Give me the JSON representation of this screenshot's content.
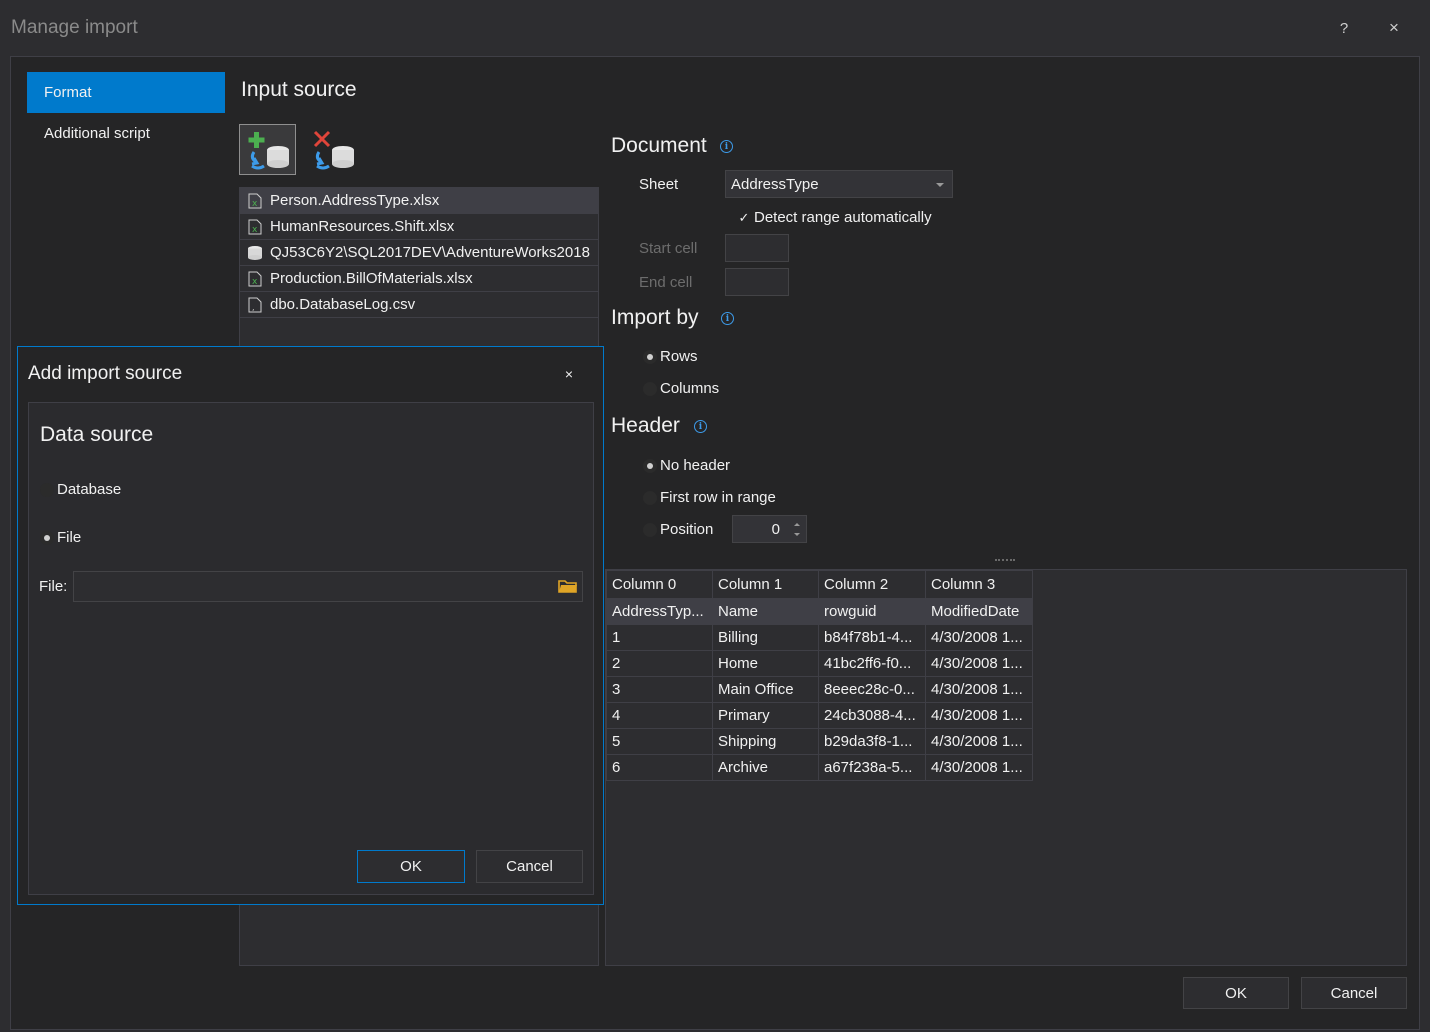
{
  "window": {
    "title": "Manage import",
    "help_label": "?",
    "close_label": "×"
  },
  "nav": [
    {
      "label": "Format"
    },
    {
      "label": "Additional script"
    }
  ],
  "input_source": {
    "heading": "Input source",
    "items": [
      {
        "label": "Person.AddressType.xlsx",
        "icon": "excel-file-icon"
      },
      {
        "label": "HumanResources.Shift.xlsx",
        "icon": "excel-file-icon"
      },
      {
        "label": "QJ53C6Y2\\SQL2017DEV\\AdventureWorks2018",
        "icon": "database-icon"
      },
      {
        "label": "Production.BillOfMaterials.xlsx",
        "icon": "excel-file-icon"
      },
      {
        "label": "dbo.DatabaseLog.csv",
        "icon": "csv-file-icon"
      }
    ]
  },
  "document": {
    "heading": "Document",
    "sheet_label": "Sheet",
    "sheet_value": "AddressType",
    "detect_range_label": "Detect range automatically",
    "start_cell_label": "Start cell",
    "end_cell_label": "End cell"
  },
  "import_by": {
    "heading": "Import by",
    "rows_label": "Rows",
    "columns_label": "Columns"
  },
  "header": {
    "heading": "Header",
    "no_header_label": "No header",
    "first_row_label": "First row in range",
    "position_label": "Position",
    "position_value": "0"
  },
  "preview": {
    "columns": [
      "Column 0",
      "Column 1",
      "Column 2",
      "Column 3"
    ],
    "header_row": [
      "AddressTyp...",
      "Name",
      "rowguid",
      "ModifiedDate"
    ],
    "rows": [
      [
        "1",
        "Billing",
        "b84f78b1-4...",
        "4/30/2008 1..."
      ],
      [
        "2",
        "Home",
        "41bc2ff6-f0...",
        "4/30/2008 1..."
      ],
      [
        "3",
        "Main Office",
        "8eeec28c-0...",
        "4/30/2008 1..."
      ],
      [
        "4",
        "Primary",
        "24cb3088-4...",
        "4/30/2008 1..."
      ],
      [
        "5",
        "Shipping",
        "b29da3f8-1...",
        "4/30/2008 1..."
      ],
      [
        "6",
        "Archive",
        "a67f238a-5...",
        "4/30/2008 1..."
      ]
    ]
  },
  "dialog": {
    "title": "Add import source",
    "close_label": "×",
    "section": "Data source",
    "database_label": "Database",
    "file_option_label": "File",
    "file_label": "File:",
    "file_value": "",
    "ok_label": "OK",
    "cancel_label": "Cancel"
  },
  "footer": {
    "ok_label": "OK",
    "cancel_label": "Cancel"
  },
  "colors": {
    "accent": "#007acc",
    "background": "#2d2d30",
    "panel": "#252526",
    "info": "#3d9be9"
  }
}
